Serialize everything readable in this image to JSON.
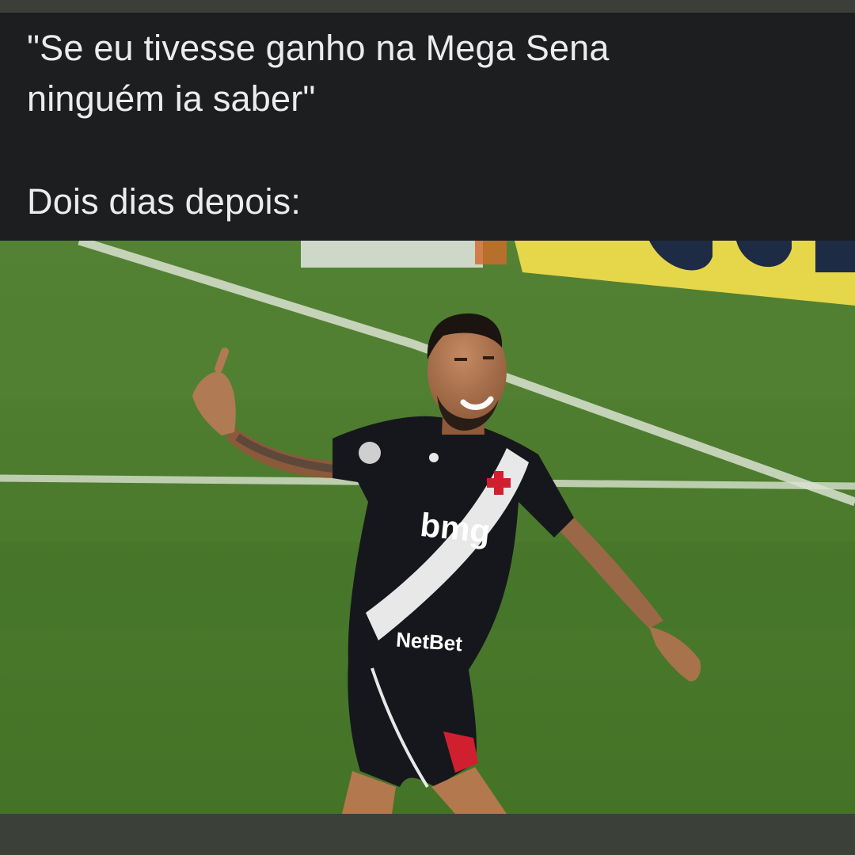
{
  "meme": {
    "caption": {
      "line1": "\"Se eu tivesse ganho na Mega Sena",
      "line2": "ninguém ia saber\"",
      "line3": "Dois dias depois:"
    },
    "photo": {
      "jersey_sponsor": "bmg",
      "shorts_sponsor": "NetBet",
      "colors": {
        "grass": "#4a7a2c",
        "jersey": "#16171c",
        "sash": "#e8e8e8",
        "cross": "#d02030",
        "banner": "#e6d64a"
      }
    }
  }
}
